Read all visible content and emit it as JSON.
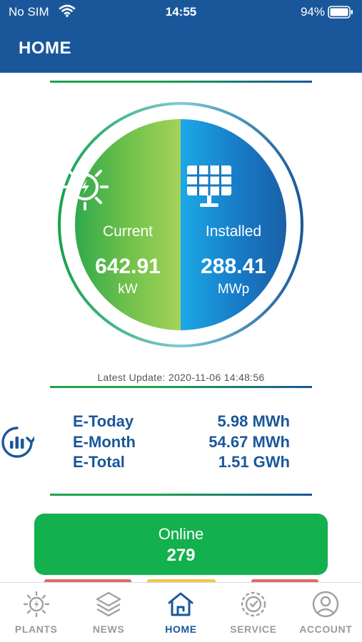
{
  "status_bar": {
    "carrier": "No SIM",
    "time": "14:55",
    "battery": "94%"
  },
  "header": {
    "title": "HOME"
  },
  "summary": {
    "current": {
      "label": "Current",
      "value": "642.91",
      "unit": "kW",
      "icon": "sun-bolt-icon"
    },
    "installed": {
      "label": "Installed",
      "value": "288.41",
      "unit": "MWp",
      "icon": "solar-panel-icon"
    },
    "latest_update": "Latest Update: 2020-11-06 14:48:56"
  },
  "energy": {
    "icon": "refresh-chart-icon",
    "rows": [
      {
        "label": "E-Today",
        "value": "5.98 MWh"
      },
      {
        "label": "E-Month",
        "value": "54.67 MWh"
      },
      {
        "label": "E-Total",
        "value": "1.51 GWh"
      }
    ]
  },
  "status_card": {
    "label": "Online",
    "count": "279"
  },
  "tabs": [
    {
      "label": "PLANTS",
      "icon": "plant-sun-icon",
      "active": false
    },
    {
      "label": "NEWS",
      "icon": "layers-icon",
      "active": false
    },
    {
      "label": "HOME",
      "icon": "home-icon",
      "active": true
    },
    {
      "label": "SERVICE",
      "icon": "gear-service-icon",
      "active": false
    },
    {
      "label": "ACCOUNT",
      "icon": "user-icon",
      "active": false
    }
  ],
  "colors": {
    "brand_blue": "#1a579a",
    "online_green": "#13b04e",
    "inactive_gray": "#9a9a9a"
  }
}
